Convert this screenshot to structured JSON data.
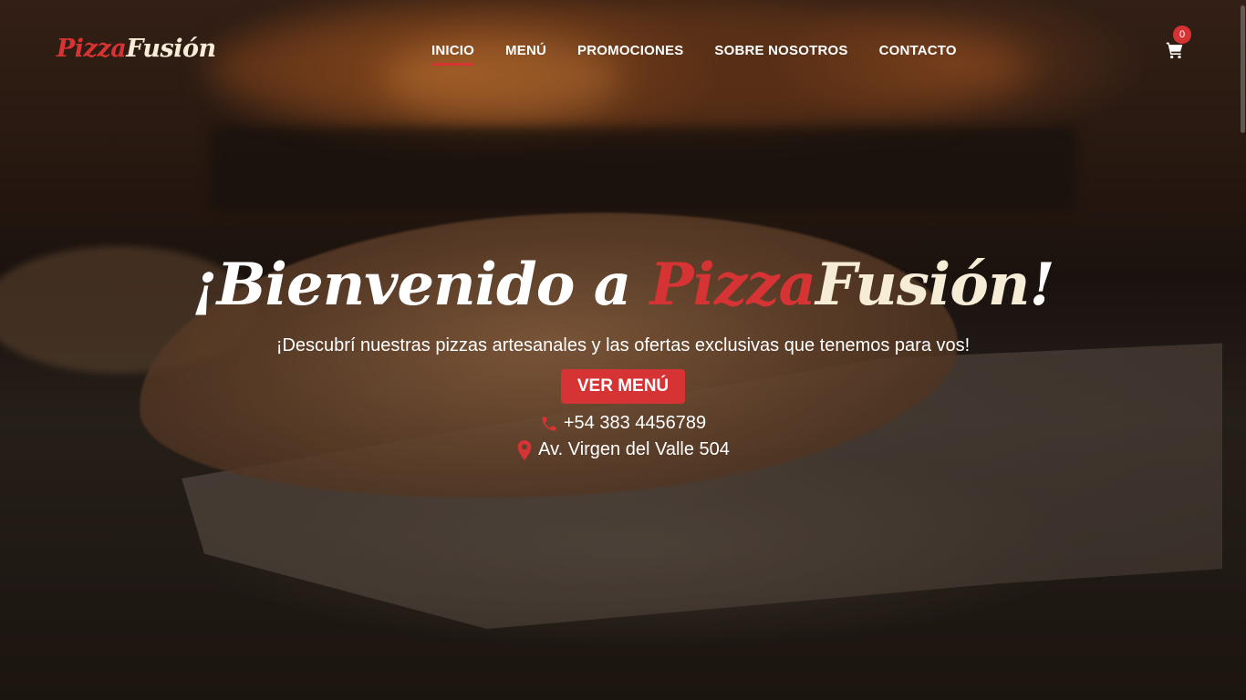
{
  "brand": {
    "part1": "Pizza",
    "part2": "Fusión"
  },
  "nav": {
    "items": [
      {
        "label": "INICIO",
        "active": true
      },
      {
        "label": "MENÚ"
      },
      {
        "label": "PROMOCIONES"
      },
      {
        "label": "SOBRE NOSOTROS"
      },
      {
        "label": "CONTACTO"
      }
    ]
  },
  "cart": {
    "icon": "cart-icon",
    "count": "0"
  },
  "hero": {
    "title_prefix": "¡Bienvenido a ",
    "title_brand1": "Pizza",
    "title_brand2": "Fusión",
    "title_suffix": "!",
    "subtitle": "¡Descubrí nuestras pizzas artesanales y las ofertas exclusivas que tenemos para vos!",
    "cta_label": "VER MENÚ",
    "phone": "+54 383 4456789",
    "phone_icon": "phone-icon",
    "address": "Av. Virgen del Valle 504",
    "address_icon": "map-pin-icon"
  },
  "colors": {
    "accent": "#d63434",
    "cream": "#f7edd6",
    "text": "#ffffff"
  }
}
